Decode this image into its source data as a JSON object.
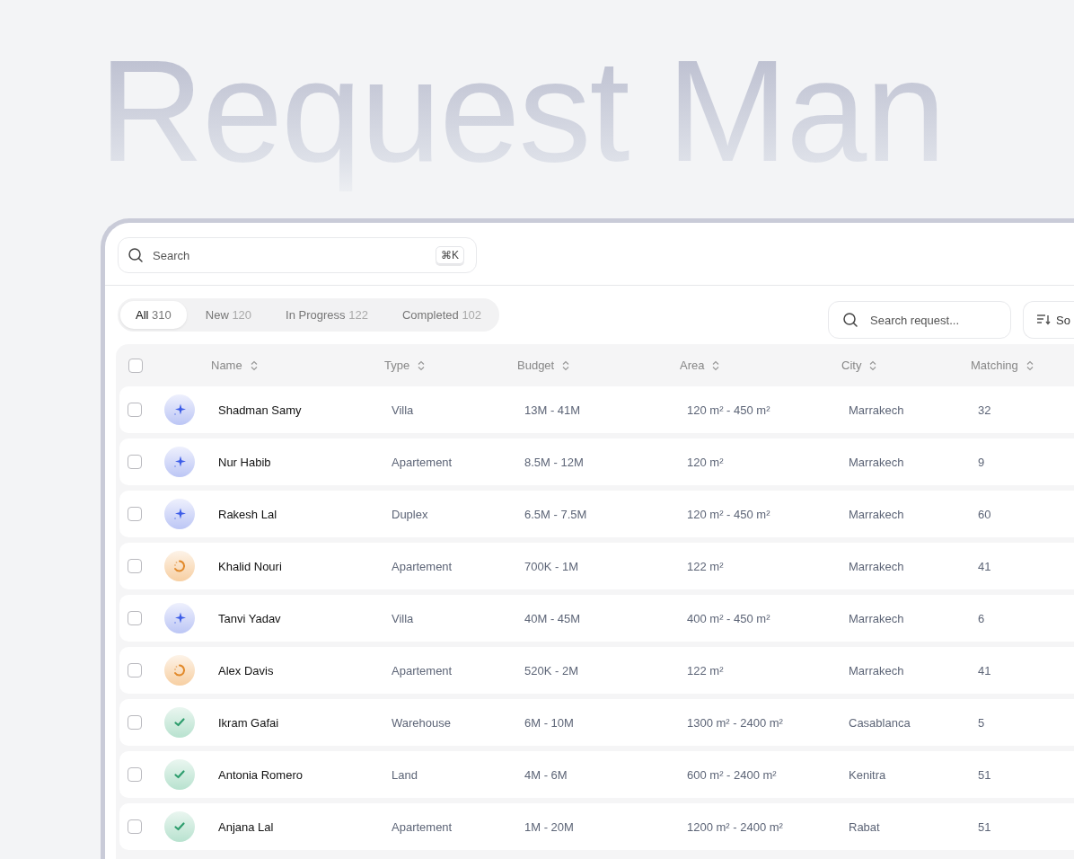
{
  "hero_title": "Request Man",
  "search": {
    "placeholder": "Search",
    "shortcut": "⌘K"
  },
  "tabs": [
    {
      "label": "All",
      "count": "310",
      "selected": true
    },
    {
      "label": "New",
      "count": "120",
      "selected": false
    },
    {
      "label": "In Progress",
      "count": "122",
      "selected": false
    },
    {
      "label": "Completed",
      "count": "102",
      "selected": false
    }
  ],
  "request_search": {
    "placeholder": "Search request..."
  },
  "sort_button": {
    "label": "So"
  },
  "table": {
    "select_all": {
      "checked": false
    },
    "columns": [
      "Name",
      "Type",
      "Budget",
      "Area",
      "City",
      "Matching"
    ],
    "rows": [
      {
        "checked": false,
        "kind": "new",
        "name": "Shadman Samy",
        "type": "Villa",
        "budget": "13M - 41M",
        "area": "120 m² - 450 m²",
        "city": "Marrakech",
        "matching": "32"
      },
      {
        "checked": false,
        "kind": "new",
        "name": "Nur Habib",
        "type": "Apartement",
        "budget": "8.5M - 12M",
        "area": "120 m²",
        "city": "Marrakech",
        "matching": "9"
      },
      {
        "checked": false,
        "kind": "new",
        "name": "Rakesh Lal",
        "type": "Duplex",
        "budget": "6.5M - 7.5M",
        "area": "120 m² - 450 m²",
        "city": "Marrakech",
        "matching": "60"
      },
      {
        "checked": false,
        "kind": "progress",
        "name": "Khalid Nouri",
        "type": "Apartement",
        "budget": "700K - 1M",
        "area": "122 m²",
        "city": "Marrakech",
        "matching": "41"
      },
      {
        "checked": false,
        "kind": "new",
        "name": "Tanvi Yadav",
        "type": "Villa",
        "budget": "40M - 45M",
        "area": "400 m² - 450 m²",
        "city": "Marrakech",
        "matching": "6"
      },
      {
        "checked": false,
        "kind": "progress",
        "name": "Alex Davis",
        "type": "Apartement",
        "budget": "520K - 2M",
        "area": "122 m²",
        "city": "Marrakech",
        "matching": "41"
      },
      {
        "checked": false,
        "kind": "done",
        "name": "Ikram Gafai",
        "type": "Warehouse",
        "budget": "6M - 10M",
        "area": "1300 m² - 2400 m²",
        "city": "Casablanca",
        "matching": "5"
      },
      {
        "checked": false,
        "kind": "done",
        "name": "Antonia Romero",
        "type": "Land",
        "budget": "4M - 6M",
        "area": "600 m² - 2400 m²",
        "city": "Kenitra",
        "matching": "51"
      },
      {
        "checked": false,
        "kind": "done",
        "name": "Anjana Lal",
        "type": "Apartement",
        "budget": "1M - 20M",
        "area": "1200 m² - 2400 m²",
        "city": "Rabat",
        "matching": "51"
      }
    ]
  }
}
